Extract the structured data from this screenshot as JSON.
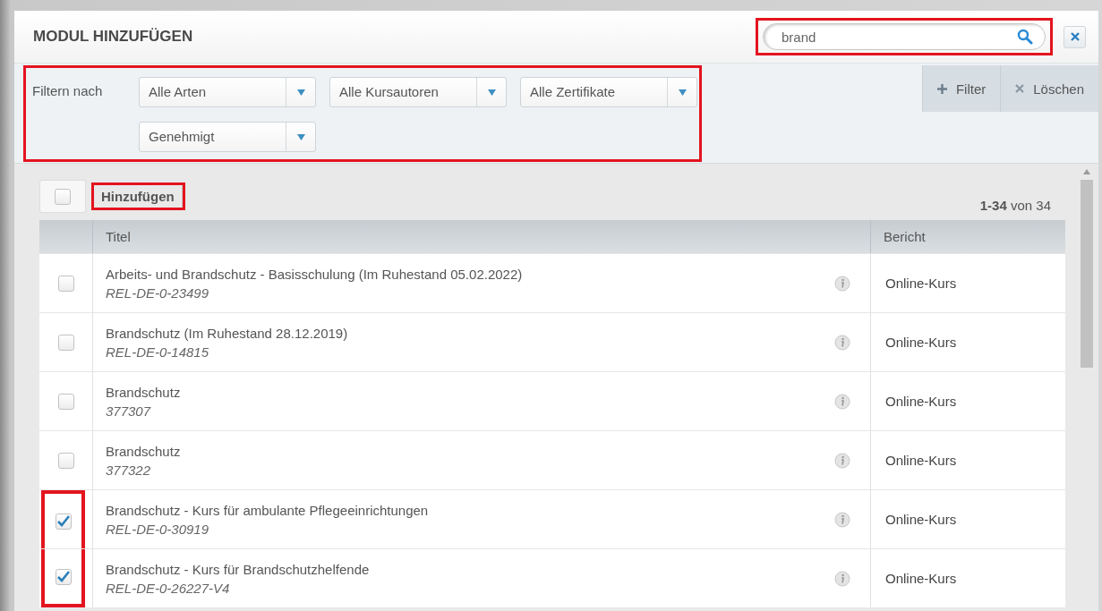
{
  "dialog": {
    "title": "MODUL HINZUFÜGEN"
  },
  "search": {
    "value": "brand",
    "highlighted": true
  },
  "filters": {
    "label": "Filtern nach",
    "highlighted": true,
    "dropdowns": [
      {
        "value": "Alle Arten"
      },
      {
        "value": "Alle Kursautoren"
      },
      {
        "value": "Alle Zertifikate"
      },
      {
        "value": "Genehmigt"
      }
    ],
    "buttons": [
      {
        "kind": "add",
        "label": "Filter"
      },
      {
        "kind": "clear",
        "label": "Löschen"
      }
    ]
  },
  "toolbar": {
    "select_all_checked": false,
    "add_button": {
      "label": "Hinzufügen",
      "highlighted": true
    },
    "count_bold": "1-34",
    "count_rest": "von 34"
  },
  "table": {
    "columns": [
      "Titel",
      "Bericht"
    ],
    "rows": [
      {
        "title": "Arbeits- und Brandschutz - Basisschulung (Im Ruhestand 05.02.2022)",
        "code": "REL-DE-0-23499",
        "report": "Online-Kurs",
        "checked": false,
        "highlighted": false
      },
      {
        "title": "Brandschutz (Im Ruhestand 28.12.2019)",
        "code": "REL-DE-0-14815",
        "report": "Online-Kurs",
        "checked": false,
        "highlighted": false
      },
      {
        "title": "Brandschutz",
        "code": "377307",
        "report": "Online-Kurs",
        "checked": false,
        "highlighted": false
      },
      {
        "title": "Brandschutz",
        "code": "377322",
        "report": "Online-Kurs",
        "checked": false,
        "highlighted": false
      },
      {
        "title": "Brandschutz - Kurs für ambulante Pflegeeinrichtungen",
        "code": "REL-DE-0-30919",
        "report": "Online-Kurs",
        "checked": true,
        "highlighted": true
      },
      {
        "title": "Brandschutz - Kurs für Brandschutzhelfende",
        "code": "REL-DE-0-26227-V4",
        "report": "Online-Kurs",
        "checked": true,
        "highlighted": true
      }
    ]
  }
}
